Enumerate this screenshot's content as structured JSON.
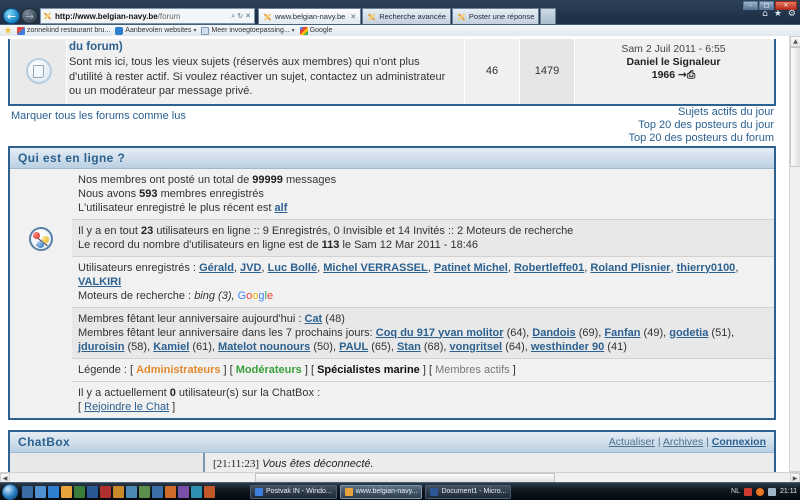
{
  "browser": {
    "address_url_host": "http://www.belgian-navy.be",
    "address_url_path": "/forum",
    "addr_icons": "⌕ ✕",
    "refresh_stop": "↻ ✕",
    "tabs": [
      {
        "title": "www.belgian-navy.be",
        "active": true,
        "close": "✕"
      },
      {
        "title": "Recherche avancée",
        "active": false,
        "close": ""
      },
      {
        "title": "Poster une réponse",
        "active": false,
        "close": ""
      }
    ],
    "favorites": [
      {
        "label": "zonnekind restaurant bru...",
        "icon": "win-icon",
        "caret": ""
      },
      {
        "label": "Aanbevolen websites",
        "icon": "blue-globe-icon",
        "caret": "▾"
      },
      {
        "label": "Meer invoegtoepassing...",
        "icon": "page-icon",
        "caret": "▾"
      },
      {
        "label": "Google",
        "icon": "google-icon",
        "caret": ""
      }
    ],
    "right_icons": "⌂ ★ ⚙",
    "window_buttons": {
      "minimize": "–",
      "maximize": "□",
      "close": "✕"
    }
  },
  "forum_row": {
    "title": "du forum)",
    "description": "Sont mis ici, tous les vieux sujets (réservés aux membres) qui n'ont plus d'utilité à rester actif. Si voulez réactiver un sujet, contactez un administrateur ou un modérateur par message privé.",
    "topics": "46",
    "posts": "1479",
    "last_post_date": "Sam 2 Juil 2011 - 6:55",
    "last_post_author": "Daniel le Signaleur",
    "last_post_author_year": "1966",
    "last_post_arrow": "→⎙"
  },
  "links": {
    "mark_all_read": "Marquer tous les forums comme lus",
    "right": [
      "Sujets actifs du jour",
      "Top 20 des posteurs du jour",
      "Top 20 des posteurs du forum"
    ]
  },
  "online_panel": {
    "header": "Qui est en ligne ?",
    "stats": {
      "total_posts_prefix": "Nos membres ont posté un total de",
      "total_posts": "99999",
      "total_posts_suffix": "messages",
      "members_prefix": "Nous avons",
      "members_count": "593",
      "members_suffix": "membres enregistrés",
      "newest_prefix": "L'utilisateur enregistré le plus récent est",
      "newest_user": "alf"
    },
    "counts": {
      "line1_a": "Il y a en tout",
      "line1_total": "23",
      "line1_b": "utilisateurs en ligne :: 9 Enregistrés, 0 Invisible et 14 Invités :: 2 Moteurs de recherche",
      "line2_a": "Le record du nombre d'utilisateurs en ligne est de",
      "line2_record": "113",
      "line2_b": "le Sam 12 Mar 2011 - 18:46"
    },
    "registered": {
      "label": "Utilisateurs enregistrés :",
      "users": [
        "Gérald",
        "JVD",
        "Luc Bollé",
        "Michel VERRASSEL",
        "Patinet Michel",
        "Robertleffe01",
        "Roland Plisnier",
        "thierry0100",
        "VALKIRI"
      ],
      "bots_label": "Moteurs de recherche :",
      "bots": "bing (3),",
      "bot_google": "Google"
    },
    "birthdays": {
      "today_label": "Membres fêtant leur anniversaire aujourd'hui :",
      "today": [
        {
          "name": "Cat",
          "age": "(48)"
        }
      ],
      "upcoming_label": "Membres fêtant leur anniversaire dans les 7 prochains jours:",
      "upcoming": [
        {
          "name": "Coq du 917 yvan molitor",
          "age": "(64)"
        },
        {
          "name": "Dandois",
          "age": "(69)"
        },
        {
          "name": "Fanfan",
          "age": "(49)"
        },
        {
          "name": "godetia",
          "age": "(51)"
        },
        {
          "name": "jduroisin",
          "age": "(58)"
        },
        {
          "name": "Kamiel",
          "age": "(61)"
        },
        {
          "name": "Matelot nounours",
          "age": "(50)"
        },
        {
          "name": "PAUL",
          "age": "(65)"
        },
        {
          "name": "Stan",
          "age": "(68)"
        },
        {
          "name": "vongritsel",
          "age": "(64)"
        },
        {
          "name": "westhinder 90",
          "age": "(41)"
        }
      ]
    },
    "legend": {
      "label": "Légende :",
      "groups": [
        {
          "name": "Administrateurs",
          "color": "#e08a2c"
        },
        {
          "name": "Modérateurs",
          "color": "#3aa03a"
        },
        {
          "name": "Spécialistes marine",
          "color": "#111111"
        },
        {
          "name": "Membres actifs",
          "color": "#777777"
        }
      ]
    },
    "chat_status": {
      "prefix": "Il y a actuellement",
      "count": "0",
      "suffix": "utilisateur(s) sur la ChatBox :",
      "join_link": "Rejoindre le Chat"
    }
  },
  "chatbox": {
    "header": "ChatBox",
    "actions": [
      {
        "label": "Actualiser",
        "bold": false
      },
      {
        "label": "Archives",
        "bold": false
      },
      {
        "label": "Connexion",
        "bold": true
      }
    ],
    "separator": "|",
    "messages": [
      {
        "time": "[21:11:23]",
        "text": "Vous êtes déconnecté."
      }
    ]
  },
  "taskbar": {
    "tasks": [
      {
        "label": "Postvak IN - Windo...",
        "color": "#3f7fe0",
        "active": false
      },
      {
        "label": "www.belgian-navy...",
        "color": "#e8a33d",
        "active": true
      },
      {
        "label": "Document1 - Micro...",
        "color": "#2b5797",
        "active": false
      }
    ],
    "clock": "21:11",
    "tray_text": "NL"
  }
}
